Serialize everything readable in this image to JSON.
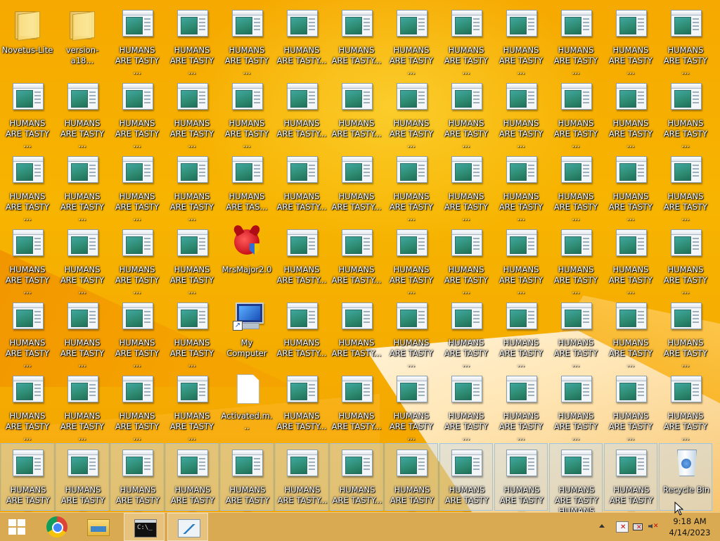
{
  "desktop": {
    "humans_label_2l": "HUMANS\nARE TASTY ...",
    "humans_label_2b": "HUMANS\nARE TASTY...",
    "special": {
      "novetus": "Novetus-Lite",
      "version": "version-a18...",
      "mrsmajor": "MrsMajor2.0",
      "mycomputer": "My Computer",
      "activated": "Activated.m...",
      "are_tas": "HUMANS\nARE TAS...",
      "three_line": "HUMANS\nARE TASTY\nHUMANS",
      "recycle": "Recycle Bin"
    },
    "icon_names": {
      "app": "app-window-icon",
      "folder": "folder-icon",
      "file": "file-icon",
      "computer": "computer-icon",
      "devil": "devil-shield-icon",
      "bin": "recycle-bin-icon"
    }
  },
  "taskbar": {
    "buttons": [
      {
        "name": "start-button",
        "icon": "windows-logo-icon"
      },
      {
        "name": "chrome-button",
        "icon": "chrome-icon"
      },
      {
        "name": "file-explorer-button",
        "icon": "file-explorer-icon"
      },
      {
        "name": "command-prompt-button",
        "icon": "command-prompt-icon",
        "glyph": "C:\\_"
      },
      {
        "name": "performance-monitor-button",
        "icon": "performance-monitor-icon"
      }
    ],
    "clock": {
      "time": "9:18 AM",
      "date": "4/14/2023"
    },
    "colors": {
      "taskbar": "#d6aa58",
      "wallpaper": "#f5a800"
    }
  }
}
